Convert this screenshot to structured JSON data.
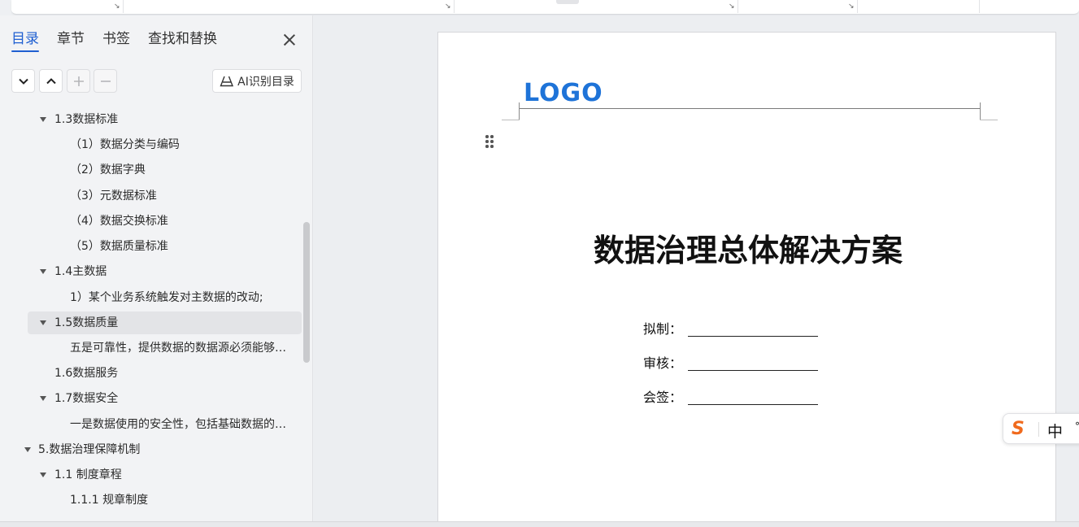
{
  "sidebar": {
    "tabs": [
      {
        "label": "目录",
        "active": true
      },
      {
        "label": "章节",
        "active": false
      },
      {
        "label": "书签",
        "active": false
      },
      {
        "label": "查找和替换",
        "active": false
      }
    ],
    "ai_button_label": "AI识别目录",
    "toc": [
      {
        "text": "1.3数据标准",
        "expanded": true
      },
      {
        "text": "（1）数据分类与编码"
      },
      {
        "text": "（2）数据字典"
      },
      {
        "text": "（3）元数据标准"
      },
      {
        "text": "（4）数据交换标准"
      },
      {
        "text": "（5）数据质量标准"
      },
      {
        "text": "1.4主数据",
        "expanded": true
      },
      {
        "text": "1）某个业务系统触发对主数据的改动;"
      },
      {
        "text": "1.5数据质量",
        "expanded": true,
        "selected": true
      },
      {
        "text": "五是可靠性，提供数据的数据源必须能够…"
      },
      {
        "text": "1.6数据服务"
      },
      {
        "text": "1.7数据安全",
        "expanded": true
      },
      {
        "text": "一是数据使用的安全性，包括基础数据的…"
      },
      {
        "text": "5.数据治理保障机制",
        "expanded": true
      },
      {
        "text": "1.1 制度章程",
        "expanded": true
      },
      {
        "text": "1.1.1 规章制度"
      }
    ]
  },
  "document": {
    "logo": "LOGO",
    "title": "数据治理总体解决方案",
    "signature_fields": [
      {
        "label": "拟制："
      },
      {
        "label": "审核："
      },
      {
        "label": "会签："
      }
    ]
  },
  "ime": {
    "logo": "S",
    "mode": "中",
    "punct": "°"
  },
  "colors": {
    "accent": "#1f5fd1",
    "logo": "#1e73d8",
    "ime": "#f06a1d"
  }
}
